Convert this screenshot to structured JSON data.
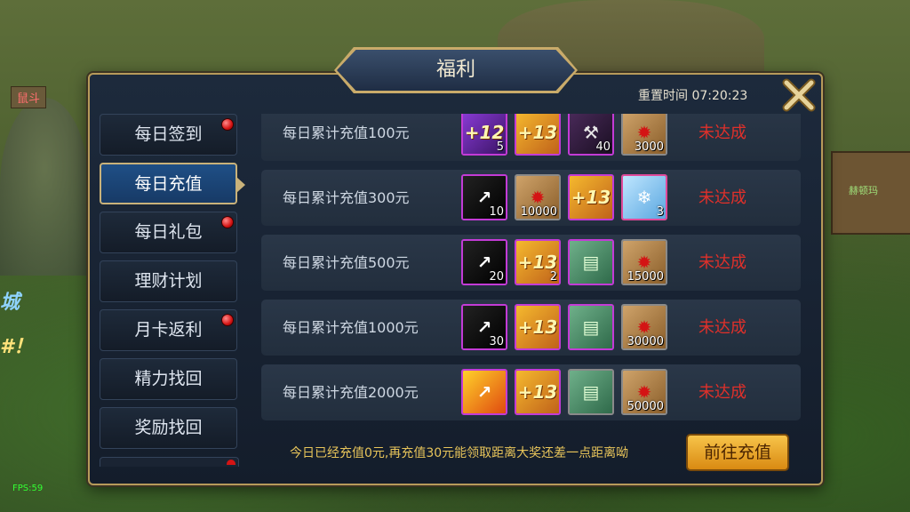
{
  "dialog": {
    "title": "福利",
    "reset_time": "重置时间 07:20:23"
  },
  "background": {
    "tag_text": "鼠斗",
    "sign_text": "赫顿玛",
    "city_text": "城",
    "city_text2": "#！",
    "fps": "FPS:59"
  },
  "sidebar": {
    "tabs": [
      {
        "label": "每日签到",
        "has_dot": true,
        "active": false
      },
      {
        "label": "每日充值",
        "has_dot": false,
        "active": true
      },
      {
        "label": "每日礼包",
        "has_dot": true,
        "active": false
      },
      {
        "label": "理财计划",
        "has_dot": false,
        "active": false
      },
      {
        "label": "月卡返利",
        "has_dot": true,
        "active": false
      },
      {
        "label": "精力找回",
        "has_dot": false,
        "active": false
      },
      {
        "label": "奖励找回",
        "has_dot": false,
        "active": false
      }
    ]
  },
  "rows": [
    {
      "label": "每日累计充值100元",
      "status": "未达成",
      "items": [
        {
          "icon": "purple-plus12-icon",
          "glyph": "+12",
          "count": "5"
        },
        {
          "icon": "gold-plus13-icon",
          "glyph": "+13",
          "count": ""
        },
        {
          "icon": "dark-anvil-icon",
          "glyph": "⚒",
          "count": "40"
        },
        {
          "icon": "scroll-icon",
          "glyph": "✹",
          "count": "3000"
        }
      ]
    },
    {
      "label": "每日累计充值300元",
      "status": "未达成",
      "items": [
        {
          "icon": "hammer-icon",
          "glyph": "↗",
          "count": "10"
        },
        {
          "icon": "scroll-icon",
          "glyph": "✹",
          "count": "10000"
        },
        {
          "icon": "gold-plus13-icon",
          "glyph": "+13",
          "count": ""
        },
        {
          "icon": "ice-crystal-icon",
          "glyph": "❄",
          "count": "3"
        }
      ]
    },
    {
      "label": "每日累计充值500元",
      "status": "未达成",
      "items": [
        {
          "icon": "hammer-icon",
          "glyph": "↗",
          "count": "20"
        },
        {
          "icon": "gold-plus13-icon",
          "glyph": "+13",
          "count": "2"
        },
        {
          "icon": "green-card-icon",
          "glyph": "▤",
          "count": ""
        },
        {
          "icon": "scroll-icon",
          "glyph": "✹",
          "count": "15000"
        }
      ]
    },
    {
      "label": "每日累计充值1000元",
      "status": "未达成",
      "items": [
        {
          "icon": "hammer-icon",
          "glyph": "↗",
          "count": "30"
        },
        {
          "icon": "gold-plus13-icon",
          "glyph": "+13",
          "count": ""
        },
        {
          "icon": "green-card-icon",
          "glyph": "▤",
          "count": ""
        },
        {
          "icon": "scroll-icon",
          "glyph": "✹",
          "count": "30000"
        }
      ]
    },
    {
      "label": "每日累计充值2000元",
      "status": "未达成",
      "items": [
        {
          "icon": "fire-hammer-icon",
          "glyph": "↗",
          "count": ""
        },
        {
          "icon": "gold-plus13-icon",
          "glyph": "+13",
          "count": ""
        },
        {
          "icon": "green-card-icon",
          "glyph": "▤",
          "count": ""
        },
        {
          "icon": "scroll-icon",
          "glyph": "✹",
          "count": "50000"
        }
      ]
    }
  ],
  "footer": {
    "message": "今日已经充值0元,再充值30元能领取距离大奖还差一点距离呦",
    "button_label": "前往充值"
  },
  "colors": {
    "status_red": "#e0302a",
    "footer_text": "#e7c45a",
    "button_gold": "#f0b030",
    "active_tab": "#1f4f86"
  }
}
